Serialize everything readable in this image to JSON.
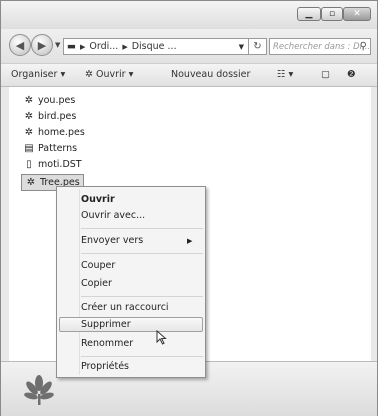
{
  "address": {
    "crumbs": [
      "Ordi...",
      "Disque ..."
    ],
    "search_placeholder": "Rechercher dans : Di..."
  },
  "toolbar": {
    "organize_label": "Organiser ▾",
    "open_label": "Ouvrir ▾",
    "new_folder_label": "Nouveau dossier"
  },
  "files": [
    {
      "name": "you.pes",
      "icon": "embroidery-file-icon"
    },
    {
      "name": "bird.pes",
      "icon": "embroidery-file-icon"
    },
    {
      "name": "home.pes",
      "icon": "embroidery-file-icon"
    },
    {
      "name": "Patterns",
      "icon": "folder-icon"
    },
    {
      "name": "moti.DST",
      "icon": "document-icon"
    },
    {
      "name": "Tree.pes",
      "icon": "embroidery-file-icon",
      "selected": true
    }
  ],
  "context_menu": {
    "items": [
      {
        "label": "Ouvrir",
        "bold": true
      },
      {
        "label": "Ouvrir avec..."
      },
      {
        "label": "Envoyer vers",
        "submenu": true
      },
      {
        "label": "Couper"
      },
      {
        "label": "Copier"
      },
      {
        "label": "Créer un raccourci"
      },
      {
        "label": "Supprimer",
        "hovered": true
      },
      {
        "label": "Renommer"
      },
      {
        "label": "Propriétés"
      }
    ]
  },
  "colors": {
    "selection_bg": "#dcdcdc",
    "menu_bg": "#f4f4f4",
    "chrome_bg": "#e9e9e9"
  }
}
